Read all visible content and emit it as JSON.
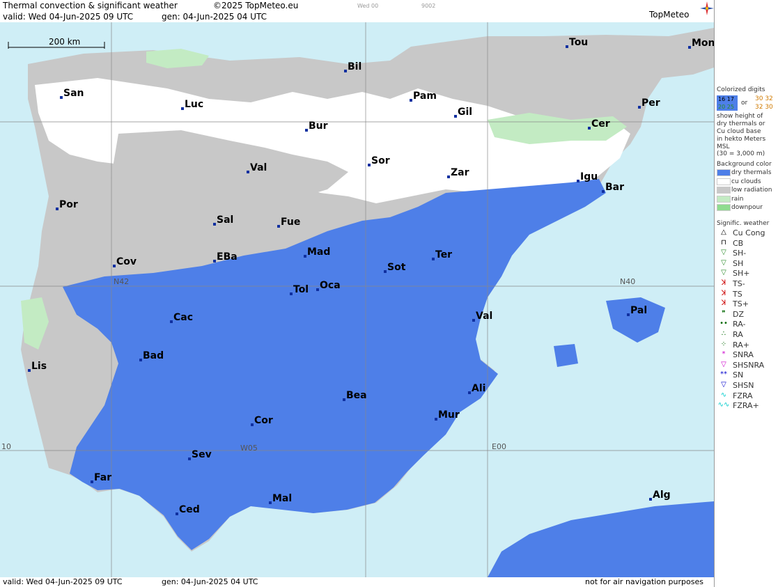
{
  "header": {
    "title": "Thermal convection & significant weather",
    "copyright": "©2025 TopMeteo.eu",
    "valid": "valid:  Wed  04-Jun-2025  09 UTC",
    "gen": "gen: 04-Jun-2025 04 UTC",
    "code1": "Wed 00",
    "code2": "9002",
    "logo": "TopMeteo"
  },
  "scale": {
    "label": "200 km"
  },
  "footer": {
    "valid": "valid:  Wed  04-Jun-2025  09 UTC",
    "gen": "gen: 04-Jun-2025 04 UTC",
    "disclaimer": "not for air navigation purposes"
  },
  "grid_labels": {
    "n40": "N40",
    "e00": "E00",
    "w05": "W05",
    "w10": "10",
    "n42": "N42"
  },
  "cities": [
    {
      "name": "San"
    },
    {
      "name": "Bil"
    },
    {
      "name": "Tou"
    },
    {
      "name": "Mon"
    },
    {
      "name": "Pam"
    },
    {
      "name": "Luc"
    },
    {
      "name": "Gil"
    },
    {
      "name": "Per"
    },
    {
      "name": "Bur"
    },
    {
      "name": "Cer"
    },
    {
      "name": "Sor"
    },
    {
      "name": "Val"
    },
    {
      "name": "Zar"
    },
    {
      "name": "Igu"
    },
    {
      "name": "Bar"
    },
    {
      "name": "Por"
    },
    {
      "name": "Sal"
    },
    {
      "name": "Fue"
    },
    {
      "name": "Mad"
    },
    {
      "name": "Cov"
    },
    {
      "name": "EBa"
    },
    {
      "name": "Ter"
    },
    {
      "name": "Sot"
    },
    {
      "name": "Tol"
    },
    {
      "name": "Oca"
    },
    {
      "name": "Pal"
    },
    {
      "name": "Cac"
    },
    {
      "name": "Val"
    },
    {
      "name": "Lis"
    },
    {
      "name": "Bad"
    },
    {
      "name": "Ali"
    },
    {
      "name": "Bea"
    },
    {
      "name": "Mur"
    },
    {
      "name": "Cor"
    },
    {
      "name": "Sev"
    },
    {
      "name": "Far"
    },
    {
      "name": "Alg"
    },
    {
      "name": "Ced"
    },
    {
      "name": "Mal"
    }
  ],
  "legend": {
    "colorized_title": "Colorized digits",
    "digits_a": "16 17",
    "digits_b": "30 32",
    "digits_or": "or",
    "digits_c": "20 25",
    "digits_d": "32 30",
    "desc1": "show height of",
    "desc2": "dry thermals or",
    "desc3": "Cu cloud base",
    "desc4": "in hekto Meters",
    "desc5": "MSL",
    "desc6": "(30 = 3,000 m)",
    "bg_title": "Background color",
    "bg_items": [
      {
        "label": "dry thermals",
        "color": "#4e7fe8"
      },
      {
        "label": "cu clouds",
        "color": "#ffffff"
      },
      {
        "label": "low radiation",
        "color": "#c8c8c8"
      },
      {
        "label": "rain",
        "color": "#c3ebc3"
      },
      {
        "label": "downpour",
        "color": "#8fdc8f"
      }
    ],
    "wx_title": "Signific. weather",
    "wx_items": [
      {
        "label": "Cu Cong",
        "symbol": "cu-cong-icon",
        "glyph": "△",
        "color": "#000"
      },
      {
        "label": "CB",
        "symbol": "cb-icon",
        "glyph": "⊓",
        "color": "#000"
      },
      {
        "label": "SH-",
        "symbol": "shower-light-icon",
        "glyph": "▽",
        "color": "#2a8a2a"
      },
      {
        "label": "SH",
        "symbol": "shower-icon",
        "glyph": "▽",
        "color": "#2a8a2a"
      },
      {
        "label": "SH+",
        "symbol": "shower-heavy-icon",
        "glyph": "▽",
        "color": "#2a8a2a"
      },
      {
        "label": "TS-",
        "symbol": "thunderstorm-light-icon",
        "glyph": "ꓘ",
        "color": "#c00"
      },
      {
        "label": "TS",
        "symbol": "thunderstorm-icon",
        "glyph": "ꓘ",
        "color": "#c00"
      },
      {
        "label": "TS+",
        "symbol": "thunderstorm-heavy-icon",
        "glyph": "ꓘ",
        "color": "#c00"
      },
      {
        "label": "DZ",
        "symbol": "drizzle-icon",
        "glyph": "❞",
        "color": "#060"
      },
      {
        "label": "RA-",
        "symbol": "rain-light-icon",
        "glyph": "••",
        "color": "#060"
      },
      {
        "label": "RA",
        "symbol": "rain-icon",
        "glyph": "∴",
        "color": "#060"
      },
      {
        "label": "RA+",
        "symbol": "rain-heavy-icon",
        "glyph": "⁘",
        "color": "#060"
      },
      {
        "label": "SNRA",
        "symbol": "snow-rain-icon",
        "glyph": "*",
        "color": "#c0c"
      },
      {
        "label": "SHSNRA",
        "symbol": "snow-rain-shower-icon",
        "glyph": "▽",
        "color": "#c0c"
      },
      {
        "label": "SN",
        "symbol": "snow-icon",
        "glyph": "**",
        "color": "#00c"
      },
      {
        "label": "SHSN",
        "symbol": "snow-shower-icon",
        "glyph": "▽",
        "color": "#00c"
      },
      {
        "label": "FZRA",
        "symbol": "freezing-rain-icon",
        "glyph": "∿",
        "color": "#0cc"
      },
      {
        "label": "FZRA+",
        "symbol": "freezing-rain-heavy-icon",
        "glyph": "∿∿",
        "color": "#0cc"
      }
    ]
  },
  "colors": {
    "sea": "#cfeef6",
    "dry_thermals": "#4e7fe8",
    "cu_clouds": "#ffffff",
    "low_radiation": "#c8c8c8",
    "rain": "#c3ebc3",
    "downpour": "#8fdc8f"
  }
}
